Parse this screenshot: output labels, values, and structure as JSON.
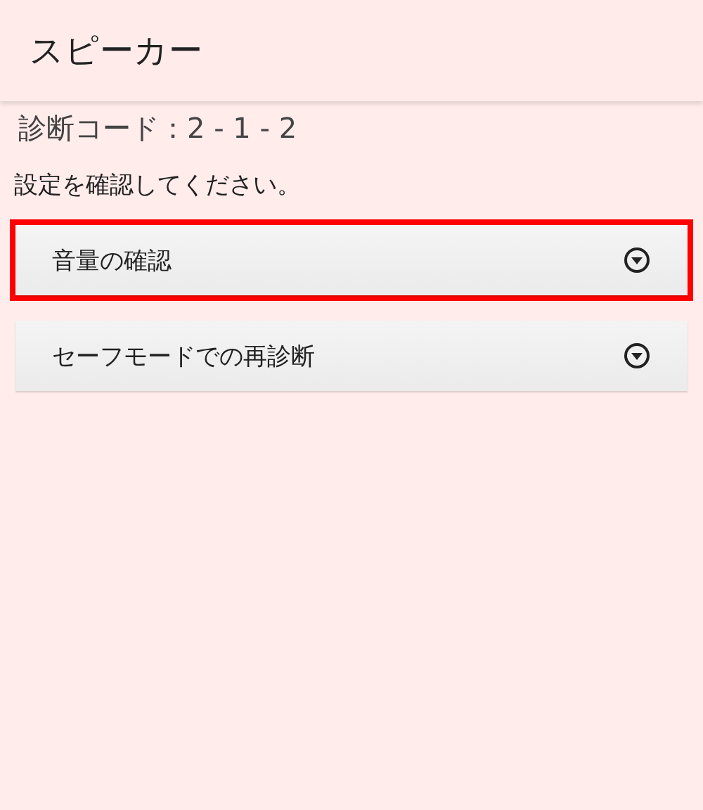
{
  "header": {
    "title": "スピーカー"
  },
  "diagnosis_code": "診断コード：2 - 1 - 2",
  "instruction": "設定を確認してください。",
  "items": [
    {
      "label": "音量の確認",
      "highlighted": true,
      "expanded": false
    },
    {
      "label": "セーフモードでの再診断",
      "highlighted": false,
      "expanded": false
    }
  ]
}
